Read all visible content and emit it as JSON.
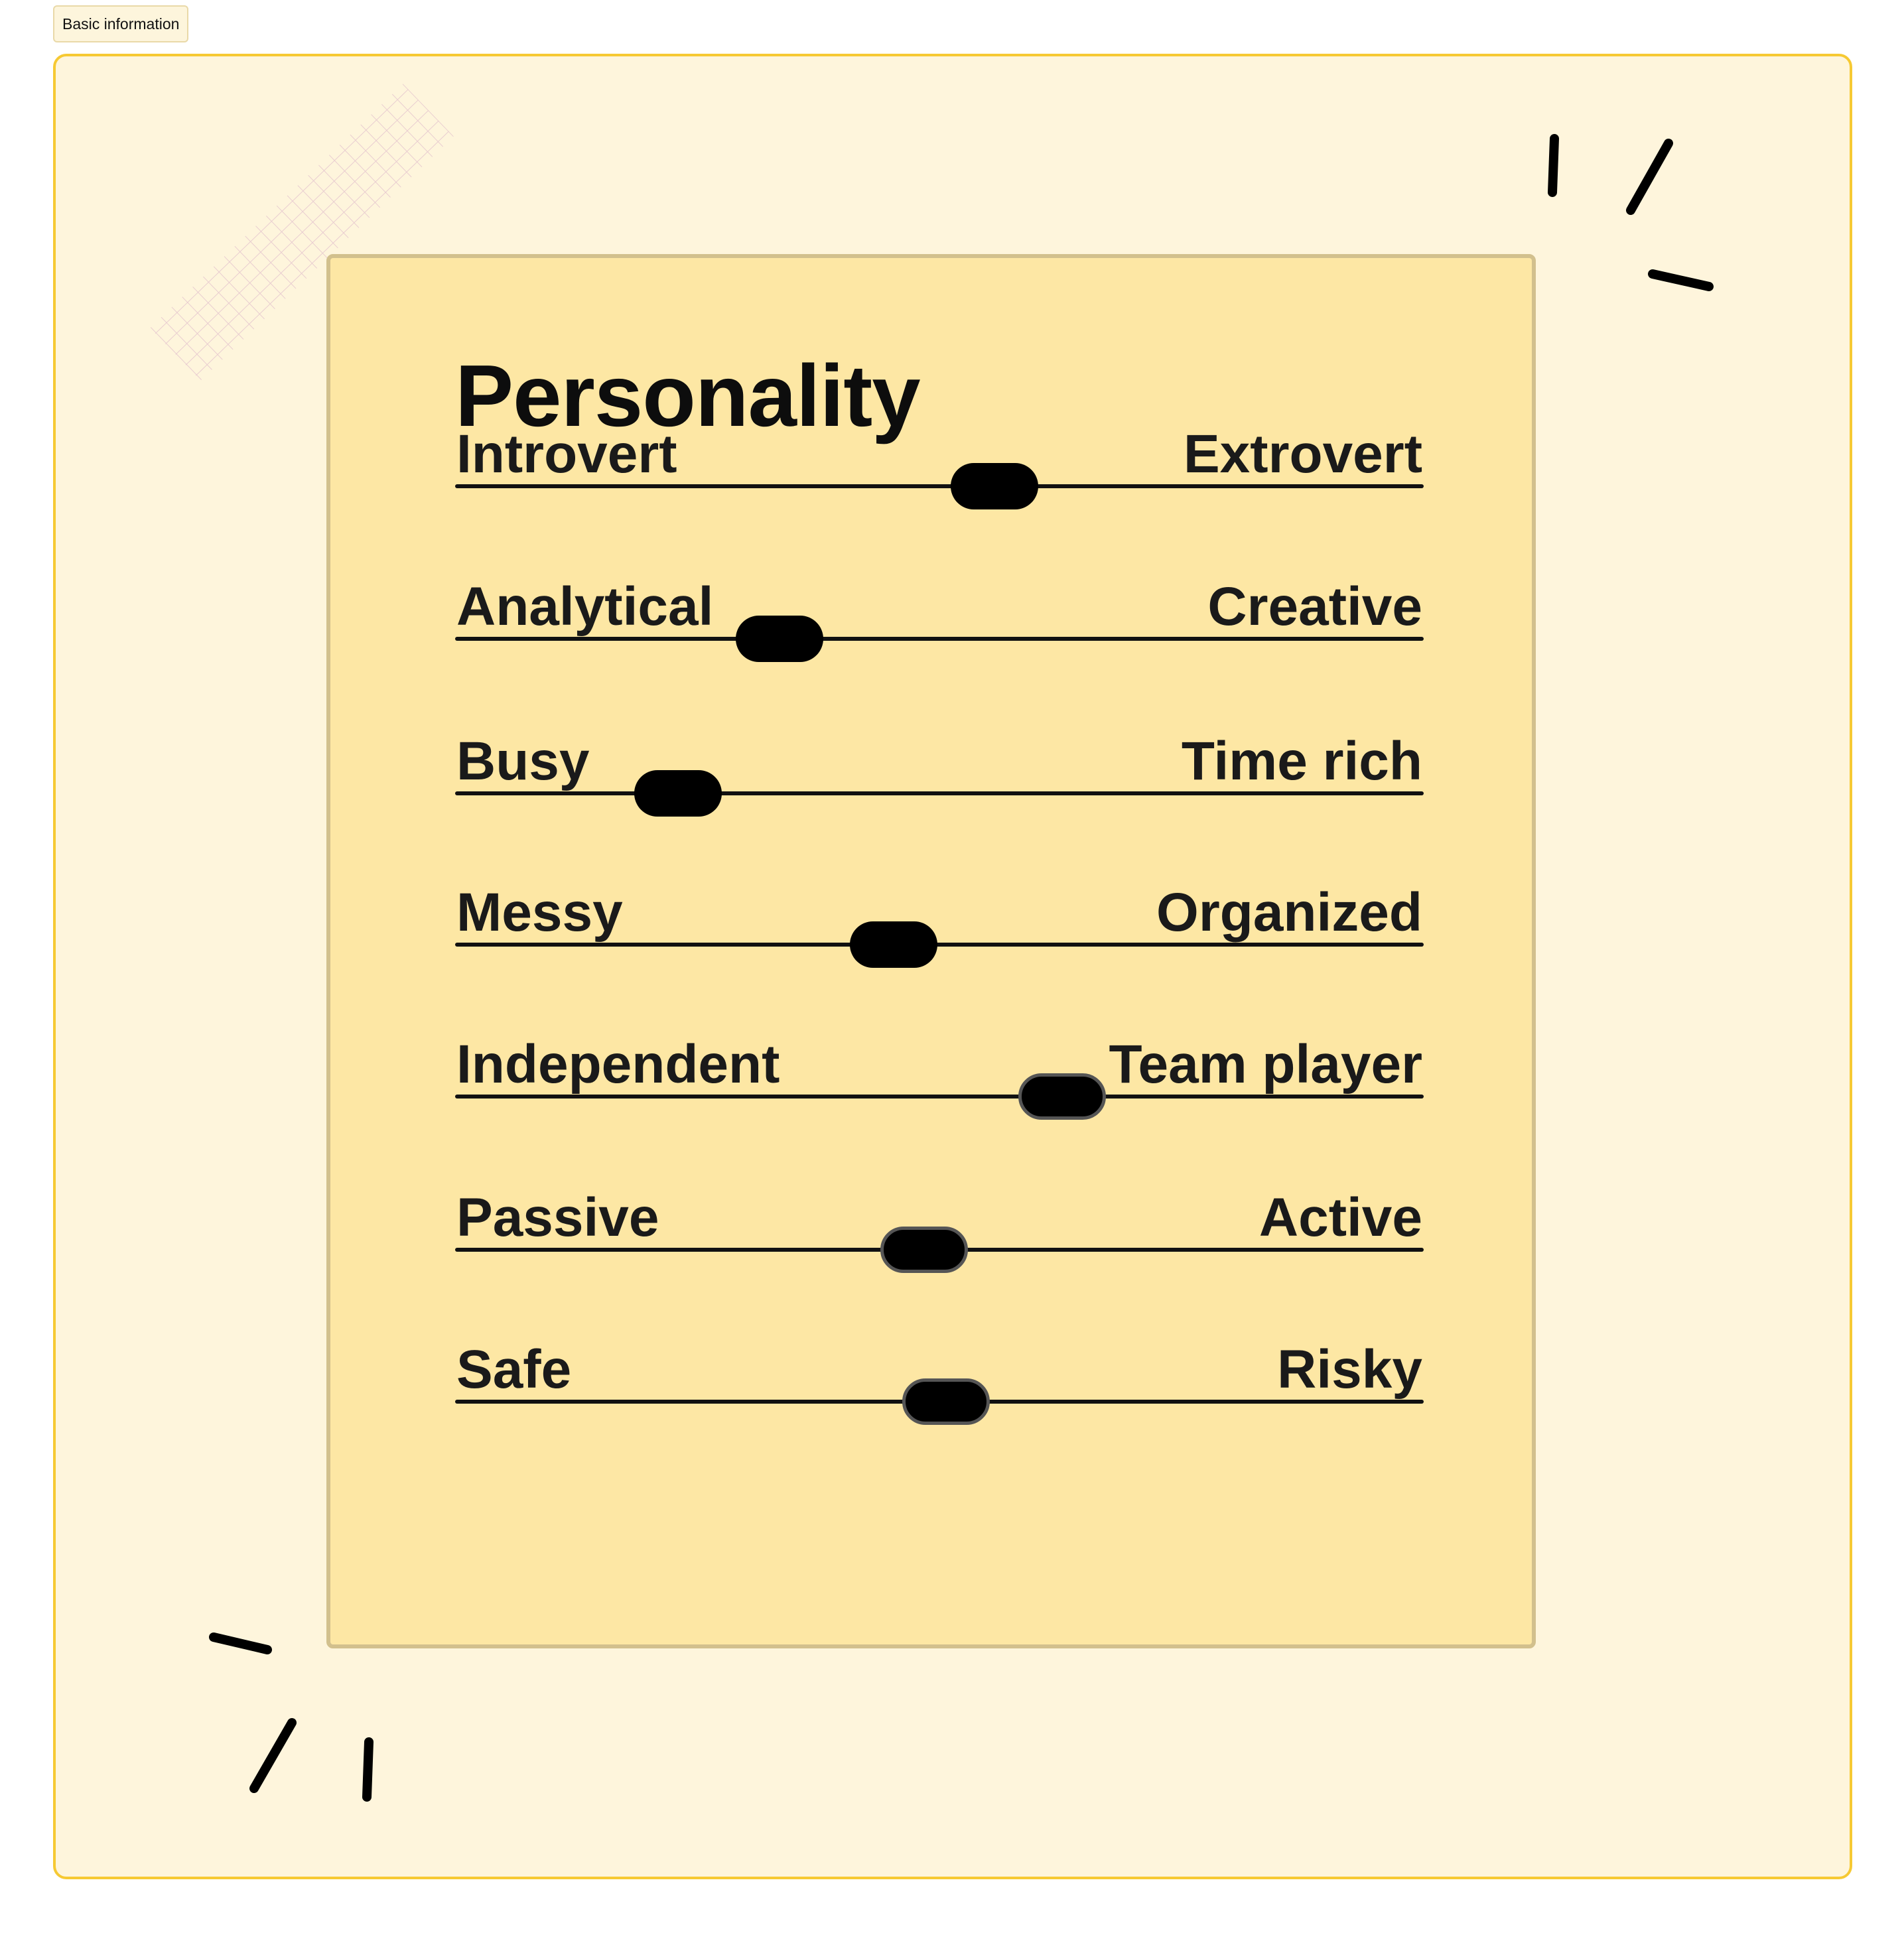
{
  "tab": {
    "label": "Basic information"
  },
  "card": {
    "title": "Personality"
  },
  "sliders": [
    {
      "left": "Introvert",
      "right": "Extrovert",
      "value": 0.557
    },
    {
      "left": "Analytical",
      "right": "Creative",
      "value": 0.335
    },
    {
      "left": "Busy",
      "right": "Time rich",
      "value": 0.23
    },
    {
      "left": "Messy",
      "right": "Organized",
      "value": 0.453
    },
    {
      "left": "Independent",
      "right": "Team player",
      "value": 0.627
    },
    {
      "left": "Passive",
      "right": "Active",
      "value": 0.484
    },
    {
      "left": "Safe",
      "right": "Risky",
      "value": 0.507
    }
  ],
  "colors": {
    "frame_border": "#f6c933",
    "frame_background": "#fef5dc",
    "card_background": "#fde7a4",
    "card_border": "#d2c08d",
    "ink": "#000000"
  }
}
